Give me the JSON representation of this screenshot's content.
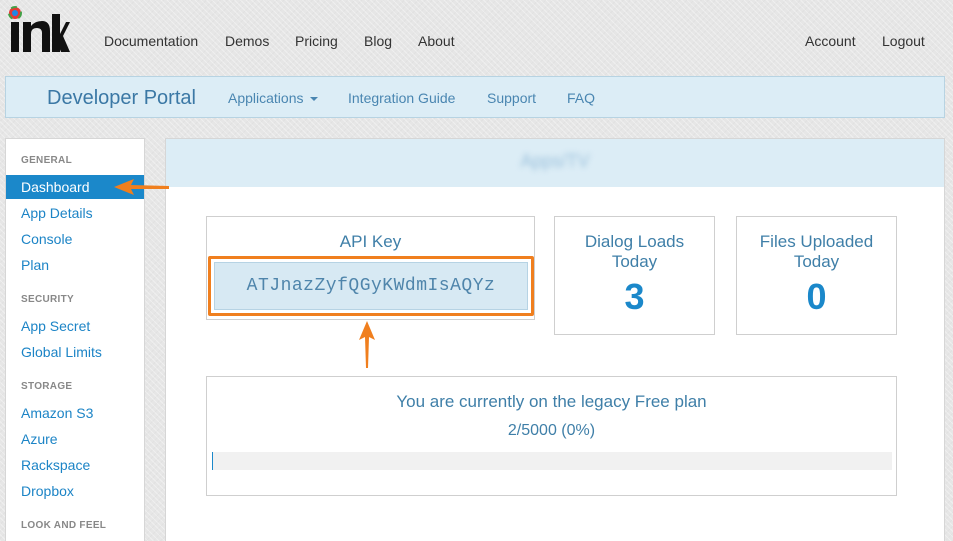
{
  "topnav": {
    "links": [
      "Documentation",
      "Demos",
      "Pricing",
      "Blog",
      "About"
    ],
    "account": "Account",
    "logout": "Logout"
  },
  "portal": {
    "title": "Developer Portal",
    "links": [
      "Applications",
      "Integration Guide",
      "Support",
      "FAQ"
    ]
  },
  "sidebar": {
    "sections": [
      {
        "header": "GENERAL",
        "items": [
          "Dashboard",
          "App Details",
          "Console",
          "Plan"
        ]
      },
      {
        "header": "SECURITY",
        "items": [
          "App Secret",
          "Global Limits"
        ]
      },
      {
        "header": "STORAGE",
        "items": [
          "Amazon S3",
          "Azure",
          "Rackspace",
          "Dropbox"
        ]
      },
      {
        "header": "LOOK AND FEEL",
        "items": []
      }
    ],
    "active_item": "Dashboard"
  },
  "dashboard": {
    "header_title": "Apps/TV",
    "api_key_label": "API Key",
    "api_key_value": "ATJnazZyfQGyKWdmIsAQYz",
    "dialog_loads_label_1": "Dialog Loads",
    "dialog_loads_label_2": "Today",
    "dialog_loads_value": "3",
    "files_uploaded_label_1": "Files Uploaded",
    "files_uploaded_label_2": "Today",
    "files_uploaded_value": "0",
    "plan_text": "You are currently on the legacy Free plan",
    "plan_usage": "2/5000 (0%)",
    "plan_usage_fraction": 0.0004
  },
  "colors": {
    "accent": "#1b88ca",
    "highlight": "#f07f1e"
  }
}
